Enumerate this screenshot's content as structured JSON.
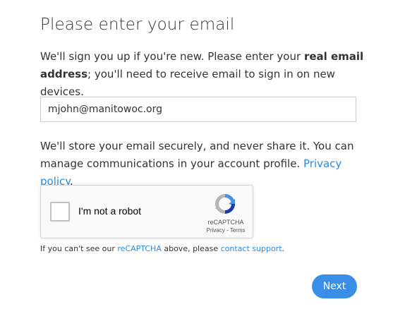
{
  "page": {
    "title": "Please enter your email"
  },
  "intro": {
    "part1": "We'll sign you up if you're new. Please enter your ",
    "bold": "real email address",
    "part2": "; you'll need to receive email to sign in on new devices."
  },
  "email_field": {
    "value": "mjohn@manitowoc.org"
  },
  "storage_notice": {
    "text": "We'll store your email securely, and never share it. You can manage communications in your account profile. ",
    "privacy_link": "Privacy policy",
    "end": "."
  },
  "captcha": {
    "label": "I'm not a robot",
    "brand": "reCAPTCHA",
    "privacy": "Privacy",
    "separator": " - ",
    "terms": "Terms",
    "checked": false
  },
  "help": {
    "part1": "If you can't see our ",
    "recaptcha_link": "reCAPTCHA",
    "part2": " above, please ",
    "support_link": "contact support",
    "end": "."
  },
  "actions": {
    "next_label": "Next"
  },
  "colors": {
    "link": "#2a8ae0",
    "button": "#3a8ee6",
    "text": "#333333"
  }
}
